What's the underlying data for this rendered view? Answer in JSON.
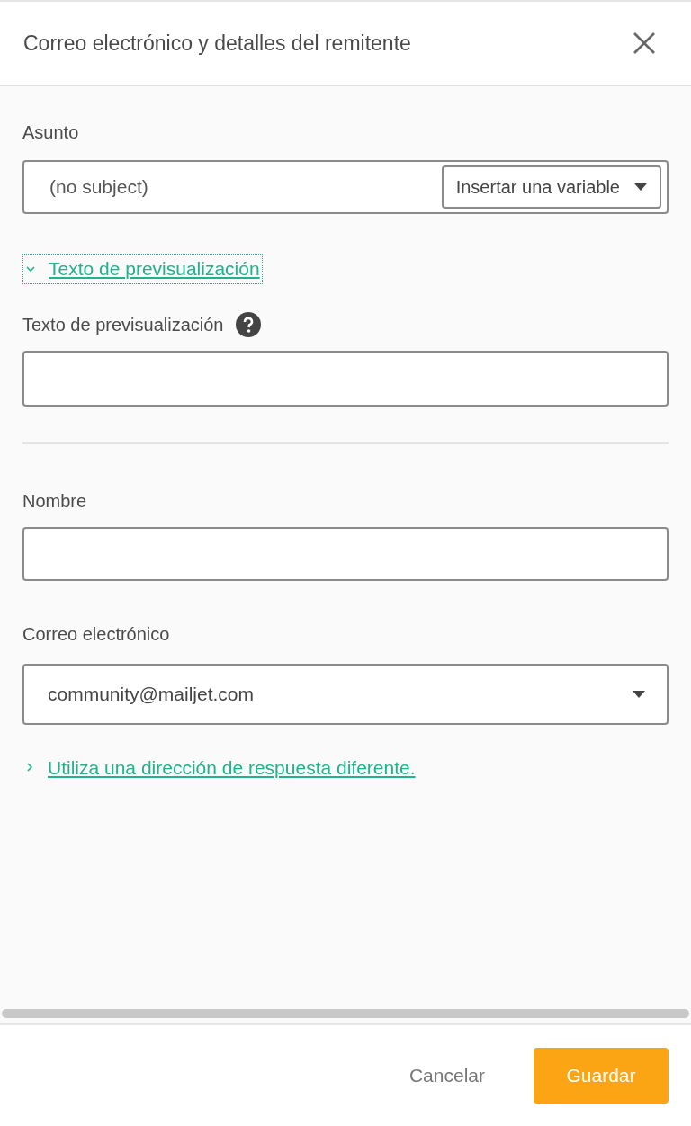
{
  "dialog": {
    "title": "Correo electrónico y detalles del remitente"
  },
  "subject": {
    "label": "Asunto",
    "placeholder": "(no subject)",
    "variable_button": "Insertar una variable"
  },
  "preview_toggle": {
    "label": "Texto de previsualización",
    "expanded": true
  },
  "preview": {
    "label": "Texto de previsualización"
  },
  "name": {
    "label": "Nombre"
  },
  "email": {
    "label": "Correo electrónico",
    "value": "community@mailjet.com"
  },
  "reply_toggle": {
    "label": "Utiliza una dirección de respuesta diferente.",
    "expanded": false
  },
  "footer": {
    "cancel": "Cancelar",
    "save": "Guardar"
  }
}
